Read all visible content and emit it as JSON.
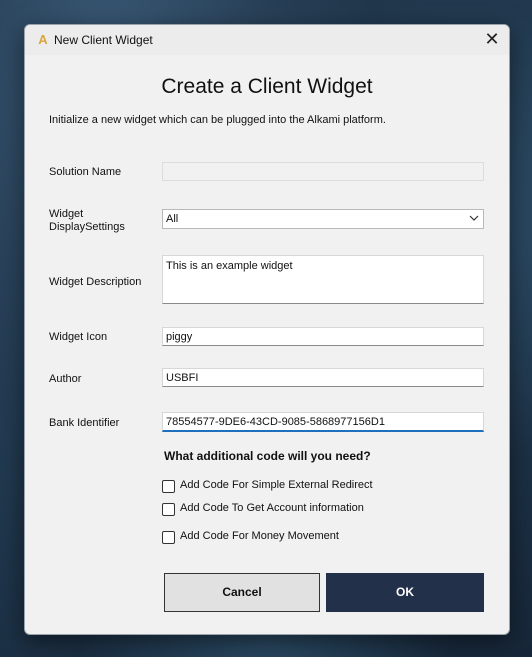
{
  "window": {
    "title": "New Client Widget",
    "app_icon": "alkami-logo-icon",
    "close_icon": "close-icon"
  },
  "header": {
    "heading": "Create a Client Widget",
    "subtitle": "Initialize a new widget which can be plugged into the Alkami platform."
  },
  "form": {
    "solution_name": {
      "label": "Solution Name",
      "value": ""
    },
    "display_settings": {
      "label_line1": "Widget",
      "label_line2": "DisplaySettings",
      "value": "All"
    },
    "description": {
      "label": "Widget Description",
      "value": "This is an example widget"
    },
    "icon": {
      "label": "Widget Icon",
      "value": "piggy"
    },
    "author": {
      "label": "Author",
      "value": "USBFI"
    },
    "bank_identifier": {
      "label": "Bank Identifier",
      "value": "78554577-9DE6-43CD-9085-5868977156D1"
    }
  },
  "options": {
    "question": "What additional code will you need?",
    "items": [
      {
        "label": "Add Code For Simple External Redirect",
        "checked": false
      },
      {
        "label": "Add Code To Get Account information",
        "checked": false
      },
      {
        "label": "Add Code For Money Movement",
        "checked": false
      }
    ]
  },
  "buttons": {
    "cancel": "Cancel",
    "ok": "OK"
  },
  "colors": {
    "primary_button": "#22304a",
    "accent_focus": "#1f6fbf",
    "dialog_bg": "#f1f1f1"
  }
}
